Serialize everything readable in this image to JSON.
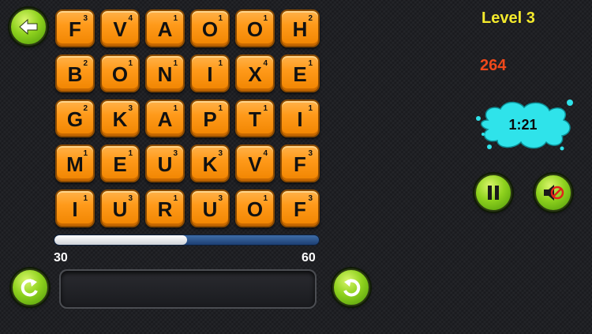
{
  "header": {
    "back_icon": "arrow-left-icon"
  },
  "board": {
    "rows": [
      [
        {
          "letter": "F",
          "score": "3"
        },
        {
          "letter": "V",
          "score": "4"
        },
        {
          "letter": "A",
          "score": "1"
        },
        {
          "letter": "O",
          "score": "1"
        },
        {
          "letter": "O",
          "score": "1"
        },
        {
          "letter": "H",
          "score": "2"
        }
      ],
      [
        {
          "letter": "B",
          "score": "2"
        },
        {
          "letter": "O",
          "score": "1"
        },
        {
          "letter": "N",
          "score": "1"
        },
        {
          "letter": "I",
          "score": "1"
        },
        {
          "letter": "X",
          "score": "4"
        },
        {
          "letter": "E",
          "score": "1"
        }
      ],
      [
        {
          "letter": "G",
          "score": "2"
        },
        {
          "letter": "K",
          "score": "3"
        },
        {
          "letter": "A",
          "score": "1"
        },
        {
          "letter": "P",
          "score": "1"
        },
        {
          "letter": "T",
          "score": "1"
        },
        {
          "letter": "I",
          "score": "1"
        }
      ],
      [
        {
          "letter": "M",
          "score": "1"
        },
        {
          "letter": "E",
          "score": "1"
        },
        {
          "letter": "U",
          "score": "3"
        },
        {
          "letter": "K",
          "score": "3"
        },
        {
          "letter": "V",
          "score": "4"
        },
        {
          "letter": "F",
          "score": "3"
        }
      ],
      [
        {
          "letter": "I",
          "score": "1"
        },
        {
          "letter": "U",
          "score": "3"
        },
        {
          "letter": "R",
          "score": "1"
        },
        {
          "letter": "U",
          "score": "3"
        },
        {
          "letter": "O",
          "score": "1"
        },
        {
          "letter": "F",
          "score": "3"
        }
      ]
    ]
  },
  "progress": {
    "min_label": "30",
    "max_label": "60",
    "fill_fraction": 0.5
  },
  "word_input": {
    "value": ""
  },
  "status": {
    "level": "Level 3",
    "score": "264",
    "timer": "1:21"
  },
  "controls": {
    "shuffle_icon": "rotate-left-icon",
    "submit_icon": "rotate-right-icon",
    "pause_icon": "pause-icon",
    "mute_icon": "speaker-muted-icon"
  },
  "colors": {
    "tile": "#ff9a1a",
    "button": "#8fd21e",
    "level": "#f4ea2c",
    "score": "#f0481a",
    "timer_splash": "#2fe3ea"
  }
}
